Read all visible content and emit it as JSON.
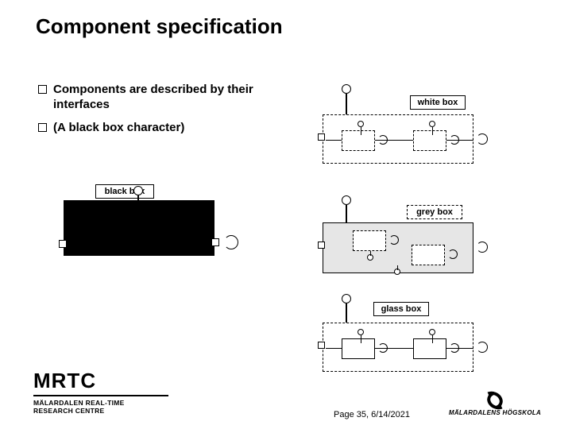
{
  "title": "Component specification",
  "bullets": [
    "Components are described by their interfaces",
    "(A black box character)"
  ],
  "boxes": {
    "black": "black box",
    "white": "white box",
    "grey": "grey box",
    "glass": "glass box"
  },
  "footer": {
    "page": "Page 35, 6/14/2021"
  },
  "logos": {
    "mrtc_acronym": "MRTC",
    "mrtc_line1": "MÄLARDALEN REAL-TIME",
    "mrtc_line2": "RESEARCH CENTRE",
    "mdh": "MÄLARDALENS HÖGSKOLA"
  }
}
